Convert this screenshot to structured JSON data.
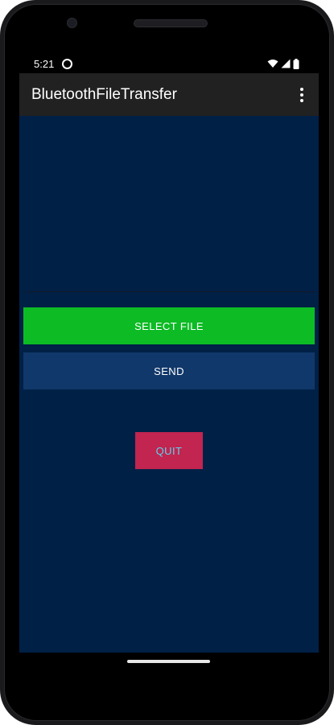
{
  "status_bar": {
    "time": "5:21",
    "notification_icon": "circle-notification-icon",
    "wifi_icon": "wifi-icon",
    "signal_icon": "signal-icon",
    "battery_icon": "battery-icon"
  },
  "app_bar": {
    "title": "BluetoothFileTransfer",
    "menu_icon": "overflow-menu-icon"
  },
  "main": {
    "select_file_label": "SELECT FILE",
    "send_label": "SEND",
    "quit_label": "QUIT"
  },
  "colors": {
    "screen_background": "#002046",
    "app_bar": "#212121",
    "select_file_button": "#0dbb24",
    "send_button": "#11386a",
    "quit_button": "#c12550",
    "quit_text": "#5ed3f0"
  }
}
